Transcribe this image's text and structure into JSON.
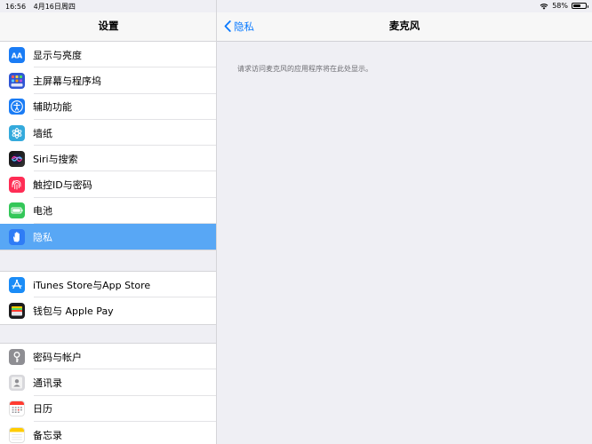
{
  "status_bar": {
    "time": "16:56",
    "date": "4月16日周四",
    "wifi_icon": "wifi-icon",
    "battery": "58%",
    "battery_level": 0.58
  },
  "sidebar": {
    "title": "设置",
    "groups": [
      {
        "items": [
          {
            "label": "显示与亮度",
            "icon": "display-brightness-icon",
            "color": "#1a7cf5"
          },
          {
            "label": "主屏幕与程序坞",
            "icon": "home-screen-dock-icon",
            "color": "#2f55d4"
          },
          {
            "label": "辅助功能",
            "icon": "accessibility-icon",
            "color": "#1a7cf5"
          },
          {
            "label": "墙纸",
            "icon": "wallpaper-icon",
            "color": "#34aadc"
          },
          {
            "label": "Siri与搜索",
            "icon": "siri-icon",
            "color": "#222222"
          },
          {
            "label": "触控ID与密码",
            "icon": "touch-id-icon",
            "color": "#ff2d55"
          },
          {
            "label": "电池",
            "icon": "battery-icon",
            "color": "#34c759"
          },
          {
            "label": "隐私",
            "icon": "privacy-hand-icon",
            "color": "#2f7cf6",
            "selected": true
          }
        ]
      },
      {
        "items": [
          {
            "label": "iTunes Store与App Store",
            "icon": "app-store-icon",
            "color": "#1a8cf7"
          },
          {
            "label": "钱包与 Apple Pay",
            "icon": "wallet-icon",
            "color": "#1c1c1e"
          }
        ]
      },
      {
        "items": [
          {
            "label": "密码与帐户",
            "icon": "key-icon",
            "color": "#8e8e93"
          },
          {
            "label": "通讯录",
            "icon": "contacts-icon",
            "color": "#c7c7cc"
          },
          {
            "label": "日历",
            "icon": "calendar-icon",
            "color": "#ffffff"
          },
          {
            "label": "备忘录",
            "icon": "notes-icon",
            "color": "#ffffff"
          }
        ]
      }
    ]
  },
  "detail": {
    "back_label": "隐私",
    "title": "麦克风",
    "message": "请求访问麦克风的应用程序将在此处显示。"
  },
  "colors": {
    "accent": "#0a7aff",
    "selection": "#58a7f5",
    "background": "#efeff4"
  }
}
